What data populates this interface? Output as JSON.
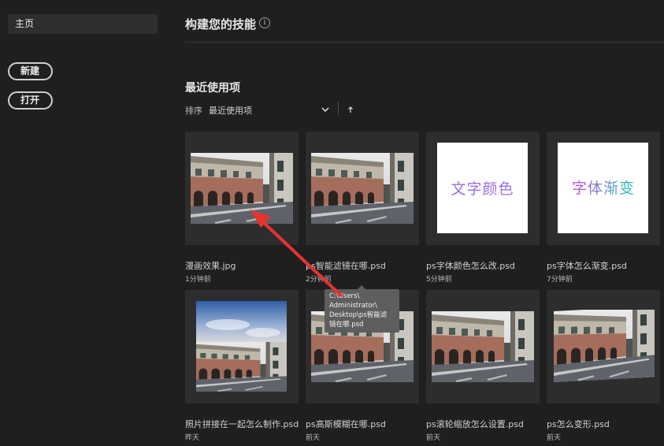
{
  "sidebar": {
    "home_label": "主页",
    "new_label": "新建",
    "open_label": "打开"
  },
  "header": {
    "title": "构建您的技能",
    "info_icon": "info-icon"
  },
  "recent": {
    "title": "最近使用项",
    "sort_label": "排序",
    "sort_value": "最近使用项"
  },
  "files": [
    {
      "name": "漫画效果.jpg",
      "time": "1分钟前"
    },
    {
      "name": "ps智能滤镜在哪.psd",
      "time": "2分钟前"
    },
    {
      "name": "ps字体颜色怎么改.psd",
      "time": "5分钟前",
      "thumb_text": "文字颜色"
    },
    {
      "name": "ps字体怎么渐变.psd",
      "time": "7分钟前",
      "thumb_text": "字体渐变"
    },
    {
      "name": "照片拼接在一起怎么制作.psd",
      "time": "昨天"
    },
    {
      "name": "ps高斯模糊在哪.psd",
      "time": "前天"
    },
    {
      "name": "ps滚轮缩放怎么设置.psd",
      "time": "前天"
    },
    {
      "name": "ps怎么变形.psd",
      "time": "前天"
    }
  ],
  "tooltip": {
    "lines": [
      "C:\\Users\\",
      "Administrator\\",
      "Desktop\\ps智能滤",
      "镜在哪.psd"
    ]
  },
  "colors": {
    "background": "#1f1f1f",
    "card": "#2d2d2d",
    "annotation_arrow": "#e8332f",
    "purple_text": "#9b6ee6"
  }
}
